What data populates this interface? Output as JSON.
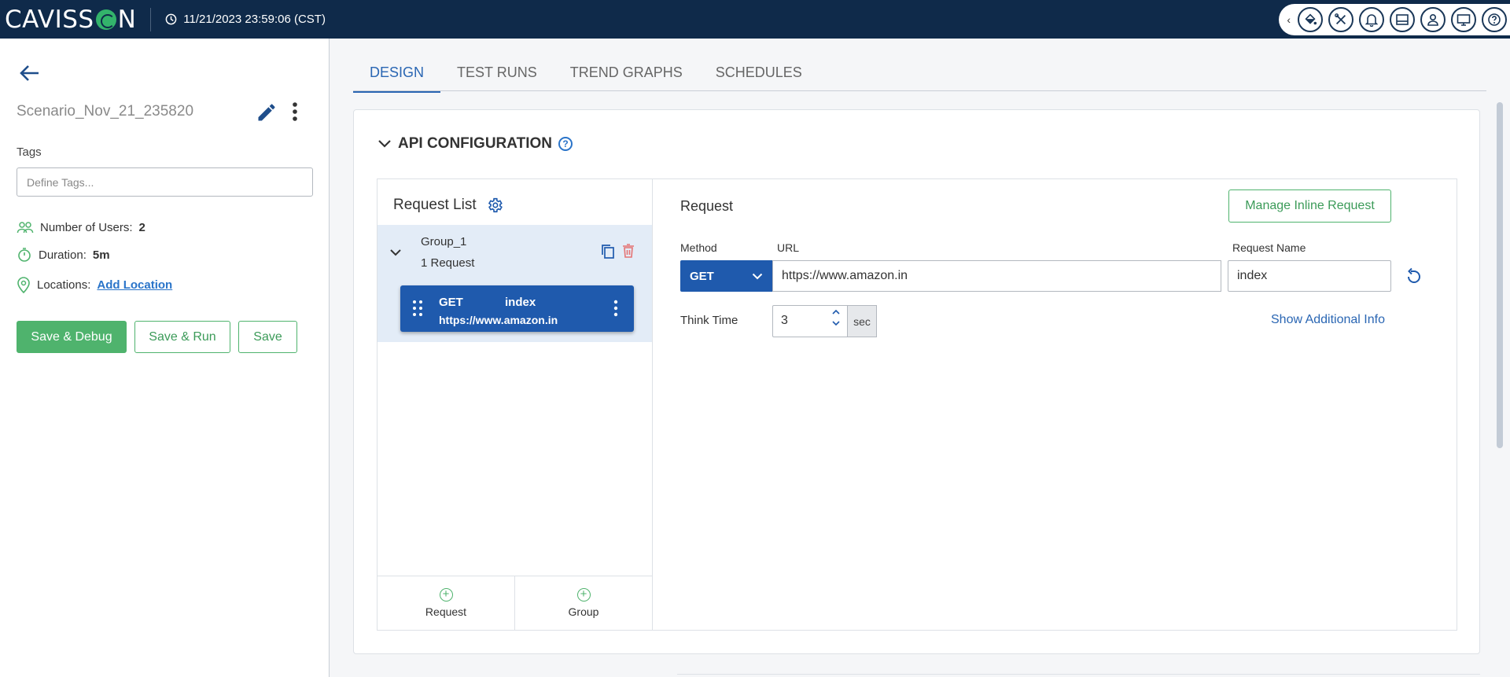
{
  "header": {
    "logo": "CAVISS",
    "logo_end": "N",
    "datetime": "11/21/2023 23:59:06 (CST)",
    "toolbar_icons": [
      "paint-bucket-icon",
      "tools-icon",
      "bell-icon",
      "monitor-panel-icon",
      "user-icon",
      "display-icon",
      "help-icon"
    ]
  },
  "sidebar": {
    "scenario_name": "Scenario_Nov_21_235820",
    "tags_label": "Tags",
    "tags_placeholder": "Define Tags...",
    "users_label": "Number of Users:",
    "users_value": "2",
    "duration_label": "Duration:",
    "duration_value": "5m",
    "locations_label": "Locations:",
    "locations_link": "Add Location",
    "buttons": {
      "save_debug": "Save & Debug",
      "save_run": "Save & Run",
      "save": "Save"
    }
  },
  "tabs": [
    {
      "label": "DESIGN",
      "active": true
    },
    {
      "label": "TEST RUNS"
    },
    {
      "label": "TREND GRAPHS"
    },
    {
      "label": "SCHEDULES"
    }
  ],
  "api_config": {
    "title": "API CONFIGURATION",
    "help_glyph": "?",
    "request_list": {
      "title": "Request List",
      "group": {
        "name": "Group_1",
        "count": "1 Request"
      },
      "item": {
        "method": "GET",
        "name": "index",
        "url": "https://www.amazon.in"
      },
      "add_request": "Request",
      "add_group": "Group"
    },
    "request": {
      "title": "Request",
      "manage_button": "Manage Inline Request",
      "method_label": "Method",
      "method_value": "GET",
      "url_label": "URL",
      "url_value": "https://www.amazon.in",
      "name_label": "Request Name",
      "name_value": "index",
      "think_label": "Think Time",
      "think_value": "3",
      "think_unit": "sec",
      "show_info": "Show Additional Info"
    }
  },
  "colors": {
    "header_bg": "#0f2a4a",
    "primary_blue": "#1f5aad",
    "green": "#4fb36d",
    "delete_red": "#e57373"
  }
}
